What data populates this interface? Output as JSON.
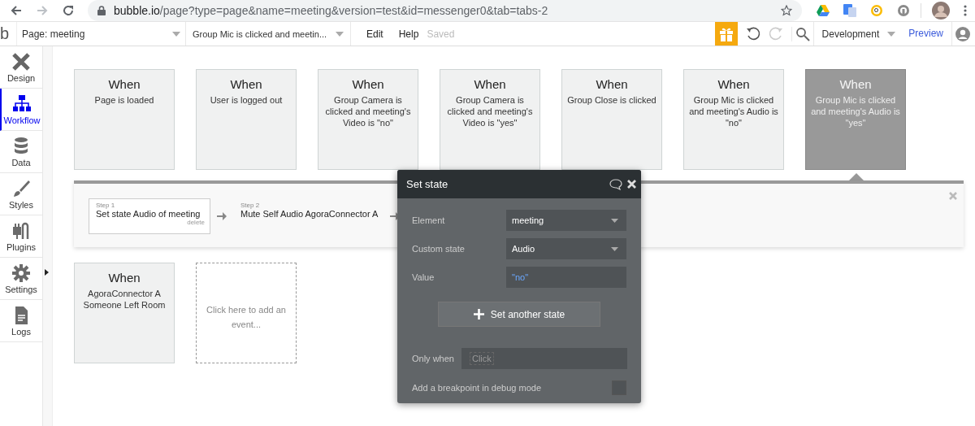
{
  "browser": {
    "url_host": "bubble.io",
    "url_path": "/page?type=page&name=meeting&version=test&id=messenger0&tab=tabs-2",
    "forward_disabled": true
  },
  "toolbar": {
    "logo": "b",
    "page_selector": "Page: meeting",
    "event_selector": "Group Mic is clicked and meetin...",
    "menu": [
      "Edit",
      "Help"
    ],
    "status": "Saved",
    "environment": "Development",
    "preview": "Preview"
  },
  "sidebar": {
    "items": [
      {
        "label": "Design",
        "selected": false
      },
      {
        "label": "Workflow",
        "selected": true
      },
      {
        "label": "Data",
        "selected": false
      },
      {
        "label": "Styles",
        "selected": false
      },
      {
        "label": "Plugins",
        "selected": false
      },
      {
        "label": "Settings",
        "selected": false
      },
      {
        "label": "Logs",
        "selected": false
      }
    ]
  },
  "events_row_1": [
    {
      "kind": "event",
      "title": "When",
      "description": "Page is loaded",
      "selected": false
    },
    {
      "kind": "event",
      "title": "When",
      "description": "User is logged out",
      "selected": false
    },
    {
      "kind": "event",
      "title": "When",
      "description": "Group Camera is clicked and meeting's Video is \"no\"",
      "selected": false
    },
    {
      "kind": "event",
      "title": "When",
      "description": "Group Camera is clicked and meeting's Video is \"yes\"",
      "selected": false
    },
    {
      "kind": "event",
      "title": "When",
      "description": "Group Close is clicked",
      "selected": false
    },
    {
      "kind": "event",
      "title": "When",
      "description": "Group Mic is clicked and meeting's Audio is \"no\"",
      "selected": false
    },
    {
      "kind": "event",
      "title": "When",
      "description": "Group Mic is clicked and meeting's Audio is \"yes\"",
      "selected": true
    }
  ],
  "steps": [
    {
      "label": "Step 1",
      "action": "Set state Audio of meeting",
      "delete": "delete",
      "selected": true
    },
    {
      "label": "Step 2",
      "action": "Mute Self Audio AgoraConnector A",
      "selected": false
    }
  ],
  "events_row_2": [
    {
      "kind": "event",
      "title": "When",
      "description": "AgoraConnector A Someone Left Room",
      "selected": false
    },
    {
      "kind": "add",
      "text": "Click here to add an event..."
    }
  ],
  "popup": {
    "title": "Set state",
    "fields": [
      {
        "label": "Element",
        "kind": "dropdown",
        "value": "meeting"
      },
      {
        "label": "Custom state",
        "kind": "dropdown",
        "value": "Audio"
      },
      {
        "label": "Value",
        "kind": "expression",
        "value": "\"no\""
      }
    ],
    "button": "Set another state",
    "only_when": {
      "label": "Only when",
      "placeholder": "Click"
    },
    "breakpoint": {
      "label": "Add a breakpoint in debug mode",
      "checked": false
    }
  }
}
